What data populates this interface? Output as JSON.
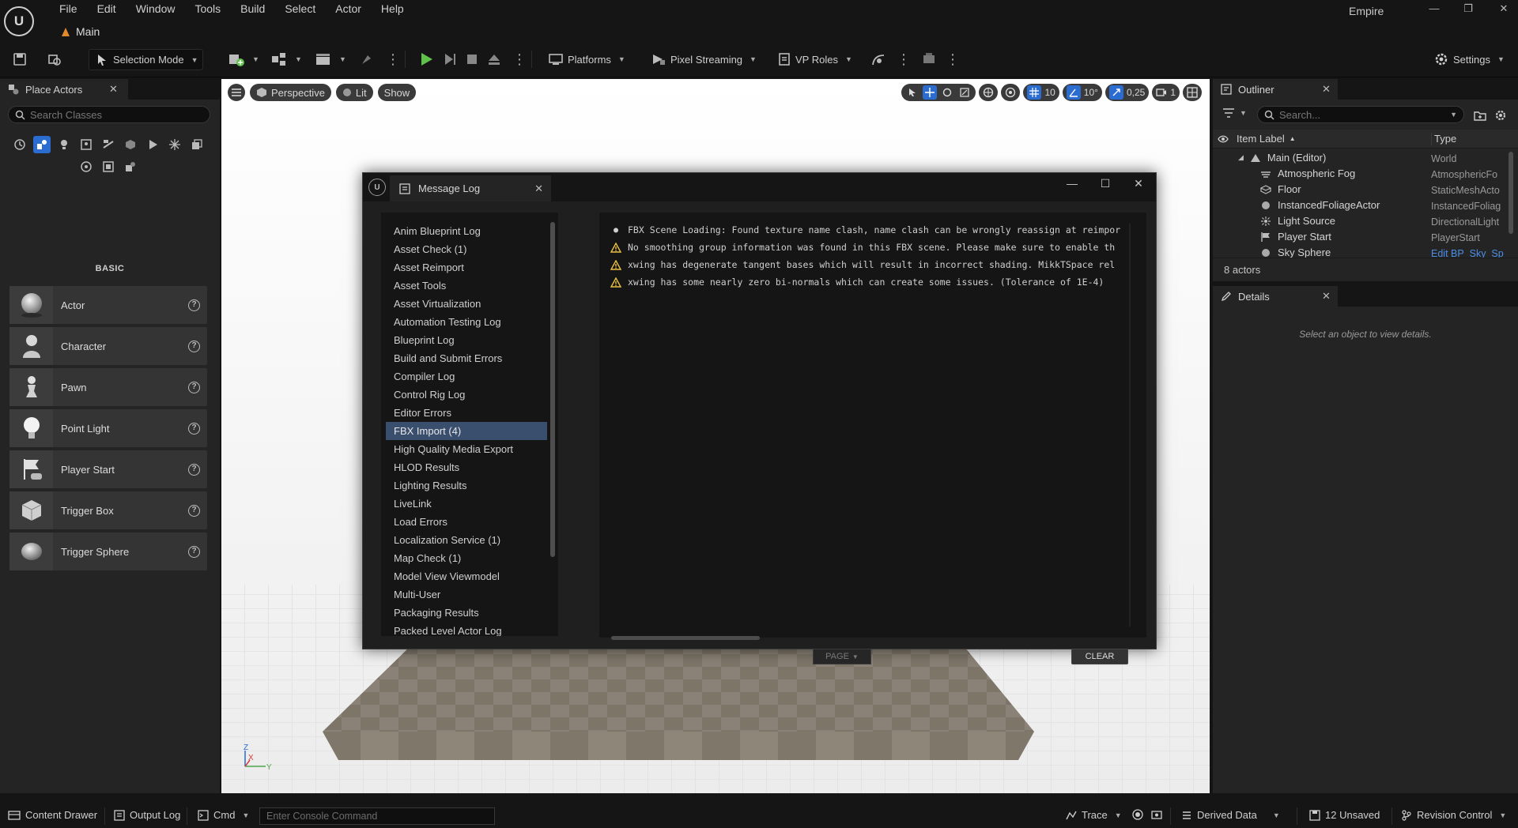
{
  "menubar": {
    "items": [
      "File",
      "Edit",
      "Window",
      "Tools",
      "Build",
      "Select",
      "Actor",
      "Help"
    ],
    "map_tab": "Main",
    "project_name": "Empire"
  },
  "toolbar": {
    "selection_mode": "Selection Mode",
    "platforms": "Platforms",
    "pixel_streaming": "Pixel Streaming",
    "vp_roles": "VP Roles",
    "settings": "Settings"
  },
  "place_actors": {
    "tab_title": "Place Actors",
    "search_placeholder": "Search Classes",
    "section_title": "BASIC",
    "items": [
      {
        "label": "Actor"
      },
      {
        "label": "Character"
      },
      {
        "label": "Pawn"
      },
      {
        "label": "Point Light"
      },
      {
        "label": "Player Start"
      },
      {
        "label": "Trigger Box"
      },
      {
        "label": "Trigger Sphere"
      }
    ]
  },
  "viewport": {
    "view_mode": "Perspective",
    "lighting": "Lit",
    "show": "Show",
    "grid_size": "10",
    "rotation_snap": "10°",
    "scale_snap": "0,25",
    "camera_speed": "1",
    "axis_z": "Z",
    "axis_x": "X",
    "axis_y": "Y"
  },
  "message_log": {
    "title": "Message Log",
    "categories": [
      "Anim Blueprint Log",
      "Asset Check (1)",
      "Asset Reimport",
      "Asset Tools",
      "Asset Virtualization",
      "Automation Testing Log",
      "Blueprint Log",
      "Build and Submit Errors",
      "Compiler Log",
      "Control Rig Log",
      "Editor Errors",
      "FBX Import (4)",
      "High Quality Media Export",
      "HLOD Results",
      "Lighting Results",
      "LiveLink",
      "Load Errors",
      "Localization Service (1)",
      "Map Check (1)",
      "Model View Viewmodel",
      "Multi-User",
      "Packaging Results",
      "Packed Level Actor Log"
    ],
    "selected_category": "FBX Import (4)",
    "messages": [
      {
        "severity": "info",
        "text": "FBX Scene Loading: Found texture name clash, name clash can be wrongly reassign at reimpor"
      },
      {
        "severity": "warning",
        "text": "No smoothing group information was found in this FBX scene.  Please make sure to enable th"
      },
      {
        "severity": "warning",
        "text": "xwing has degenerate tangent bases which will result in incorrect shading.  MikkTSpace rel"
      },
      {
        "severity": "warning",
        "text": "xwing has some nearly zero bi-normals which can create some issues. (Tolerance of 1E-4)"
      }
    ],
    "page_label": "PAGE",
    "clear_label": "CLEAR"
  },
  "outliner": {
    "tab_title": "Outliner",
    "search_placeholder": "Search...",
    "col_label": "Item Label",
    "col_type": "Type",
    "rows": [
      {
        "label": "Main (Editor)",
        "type": "World"
      },
      {
        "label": "Atmospheric Fog",
        "type": "AtmosphericFo"
      },
      {
        "label": "Floor",
        "type": "StaticMeshActo"
      },
      {
        "label": "InstancedFoliageActor",
        "type": "InstancedFoliag"
      },
      {
        "label": "Light Source",
        "type": "DirectionalLight"
      },
      {
        "label": "Player Start",
        "type": "PlayerStart"
      },
      {
        "label": "Sky Sphere",
        "type": "Edit BP_Sky_Sp"
      }
    ],
    "count": "8 actors"
  },
  "details": {
    "tab_title": "Details",
    "empty_text": "Select an object to view details."
  },
  "statusbar": {
    "content_drawer": "Content Drawer",
    "output_log": "Output Log",
    "cmd": "Cmd",
    "console_placeholder": "Enter Console Command",
    "trace": "Trace",
    "derived_data": "Derived Data",
    "unsaved": "12 Unsaved",
    "revision_control": "Revision Control"
  },
  "colors": {
    "accent_blue": "#2b6cd1",
    "selection": "#3a4e6e",
    "play_green": "#5fc34a",
    "warning_yellow": "#e9c043"
  }
}
